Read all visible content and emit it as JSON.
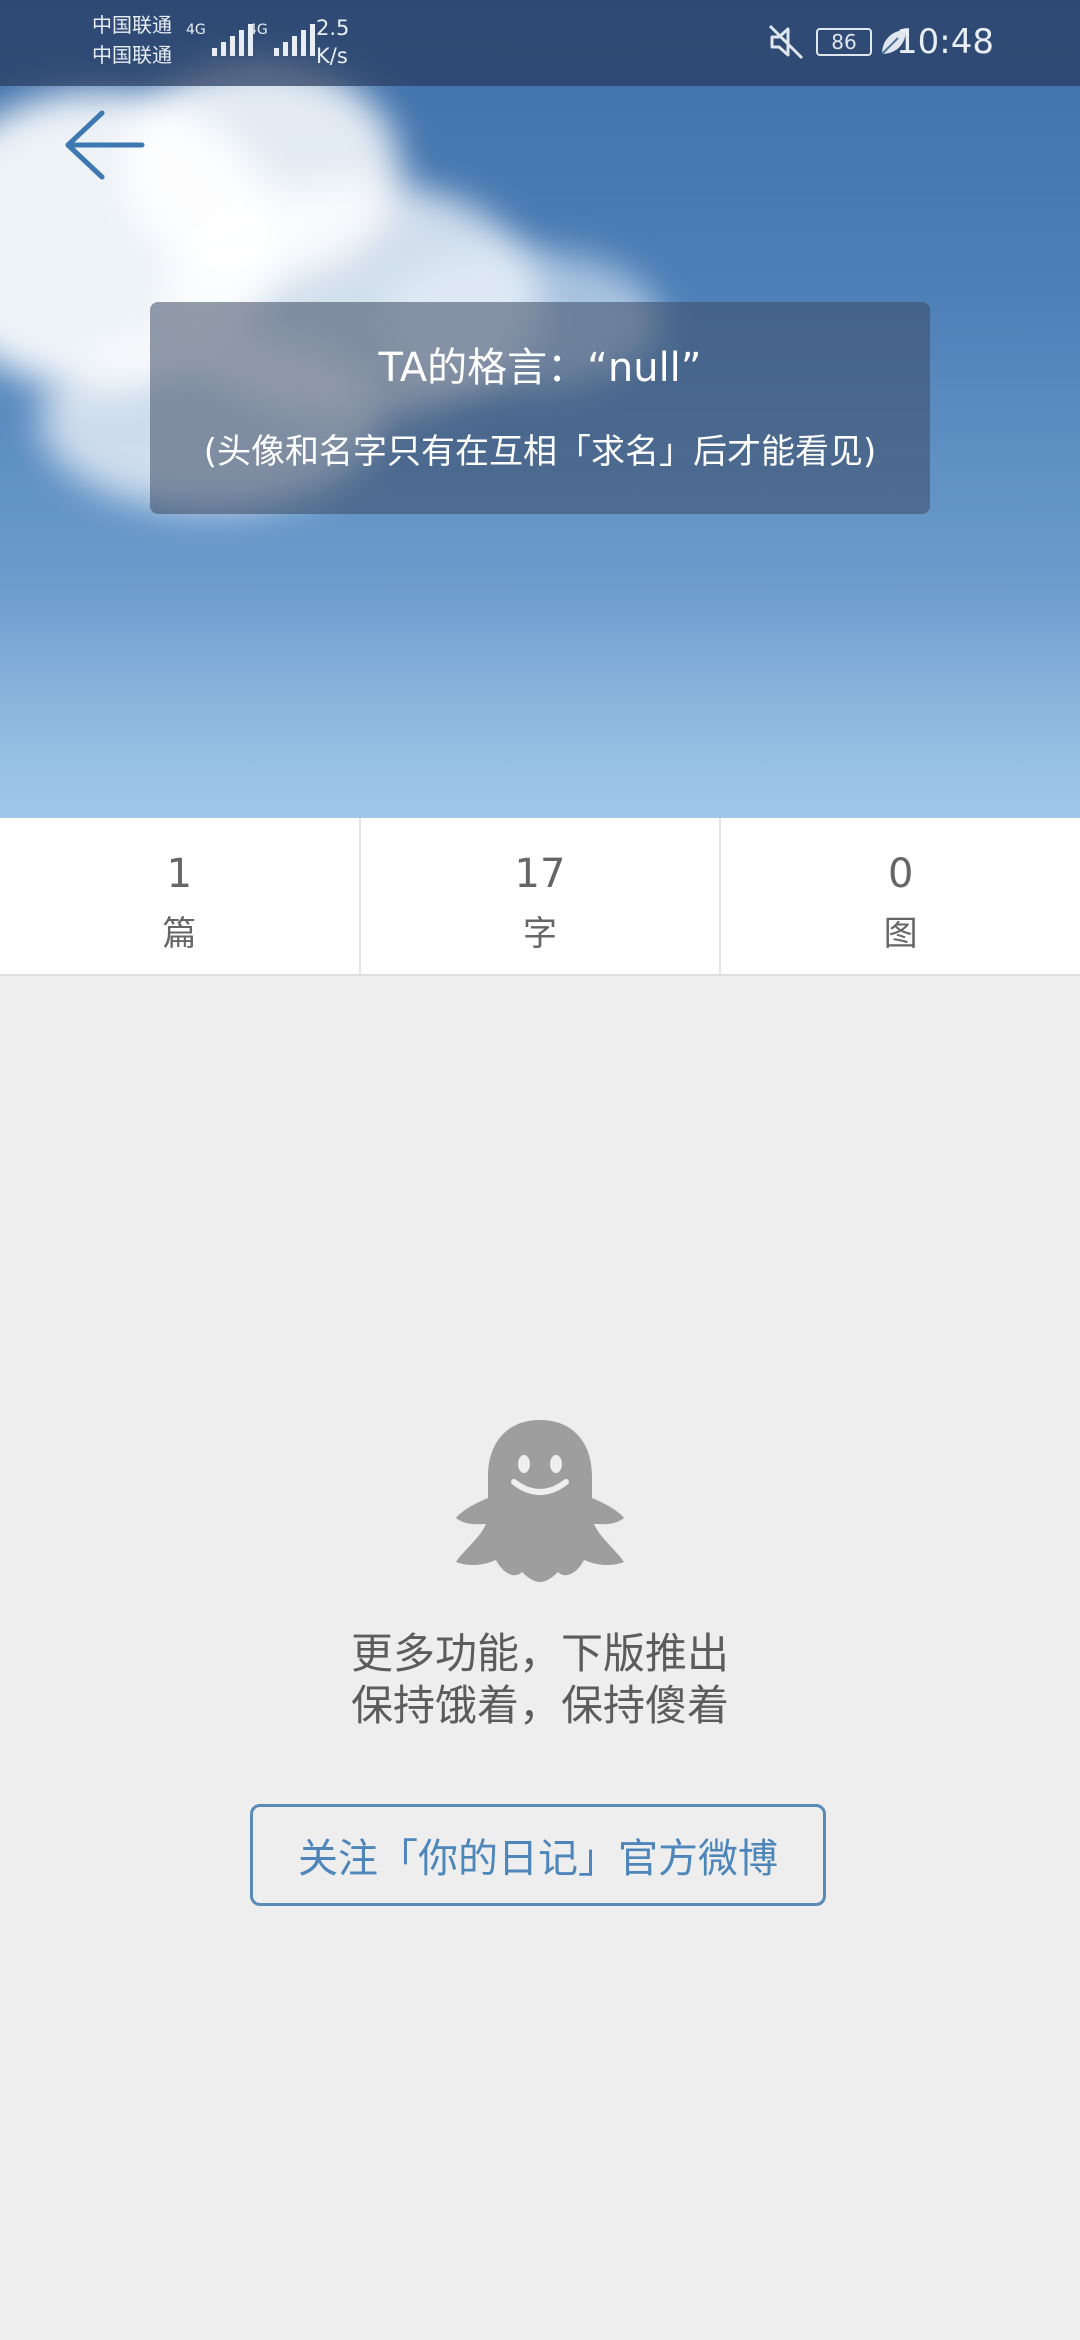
{
  "status_bar": {
    "carrier_1": "中国联通",
    "carrier_2": "中国联通",
    "network_1": "4G",
    "network_2": "4G",
    "speed_value": "2.5",
    "speed_unit": "K/s",
    "battery": "86",
    "time": "10:48",
    "icons": [
      "mute-icon",
      "battery-icon",
      "leaf-icon",
      "signal-icon"
    ]
  },
  "header": {
    "back_icon": "arrow-left-icon",
    "motto_title": "TA的格言：“null”",
    "motto_note": "(头像和名字只有在互相「求名」后才能看见)"
  },
  "stats": [
    {
      "value": "1",
      "label": "篇"
    },
    {
      "value": "17",
      "label": "字"
    },
    {
      "value": "0",
      "label": "图"
    }
  ],
  "empty_state": {
    "icon": "ghost-icon",
    "line_1": "更多功能，下版推出",
    "line_2": "保持饿着，保持傻着",
    "button_label": "关注「你的日记」官方微博"
  },
  "colors": {
    "accent": "#4f86ba",
    "background": "#eeeeef",
    "ghost": "#9e9e9e"
  }
}
